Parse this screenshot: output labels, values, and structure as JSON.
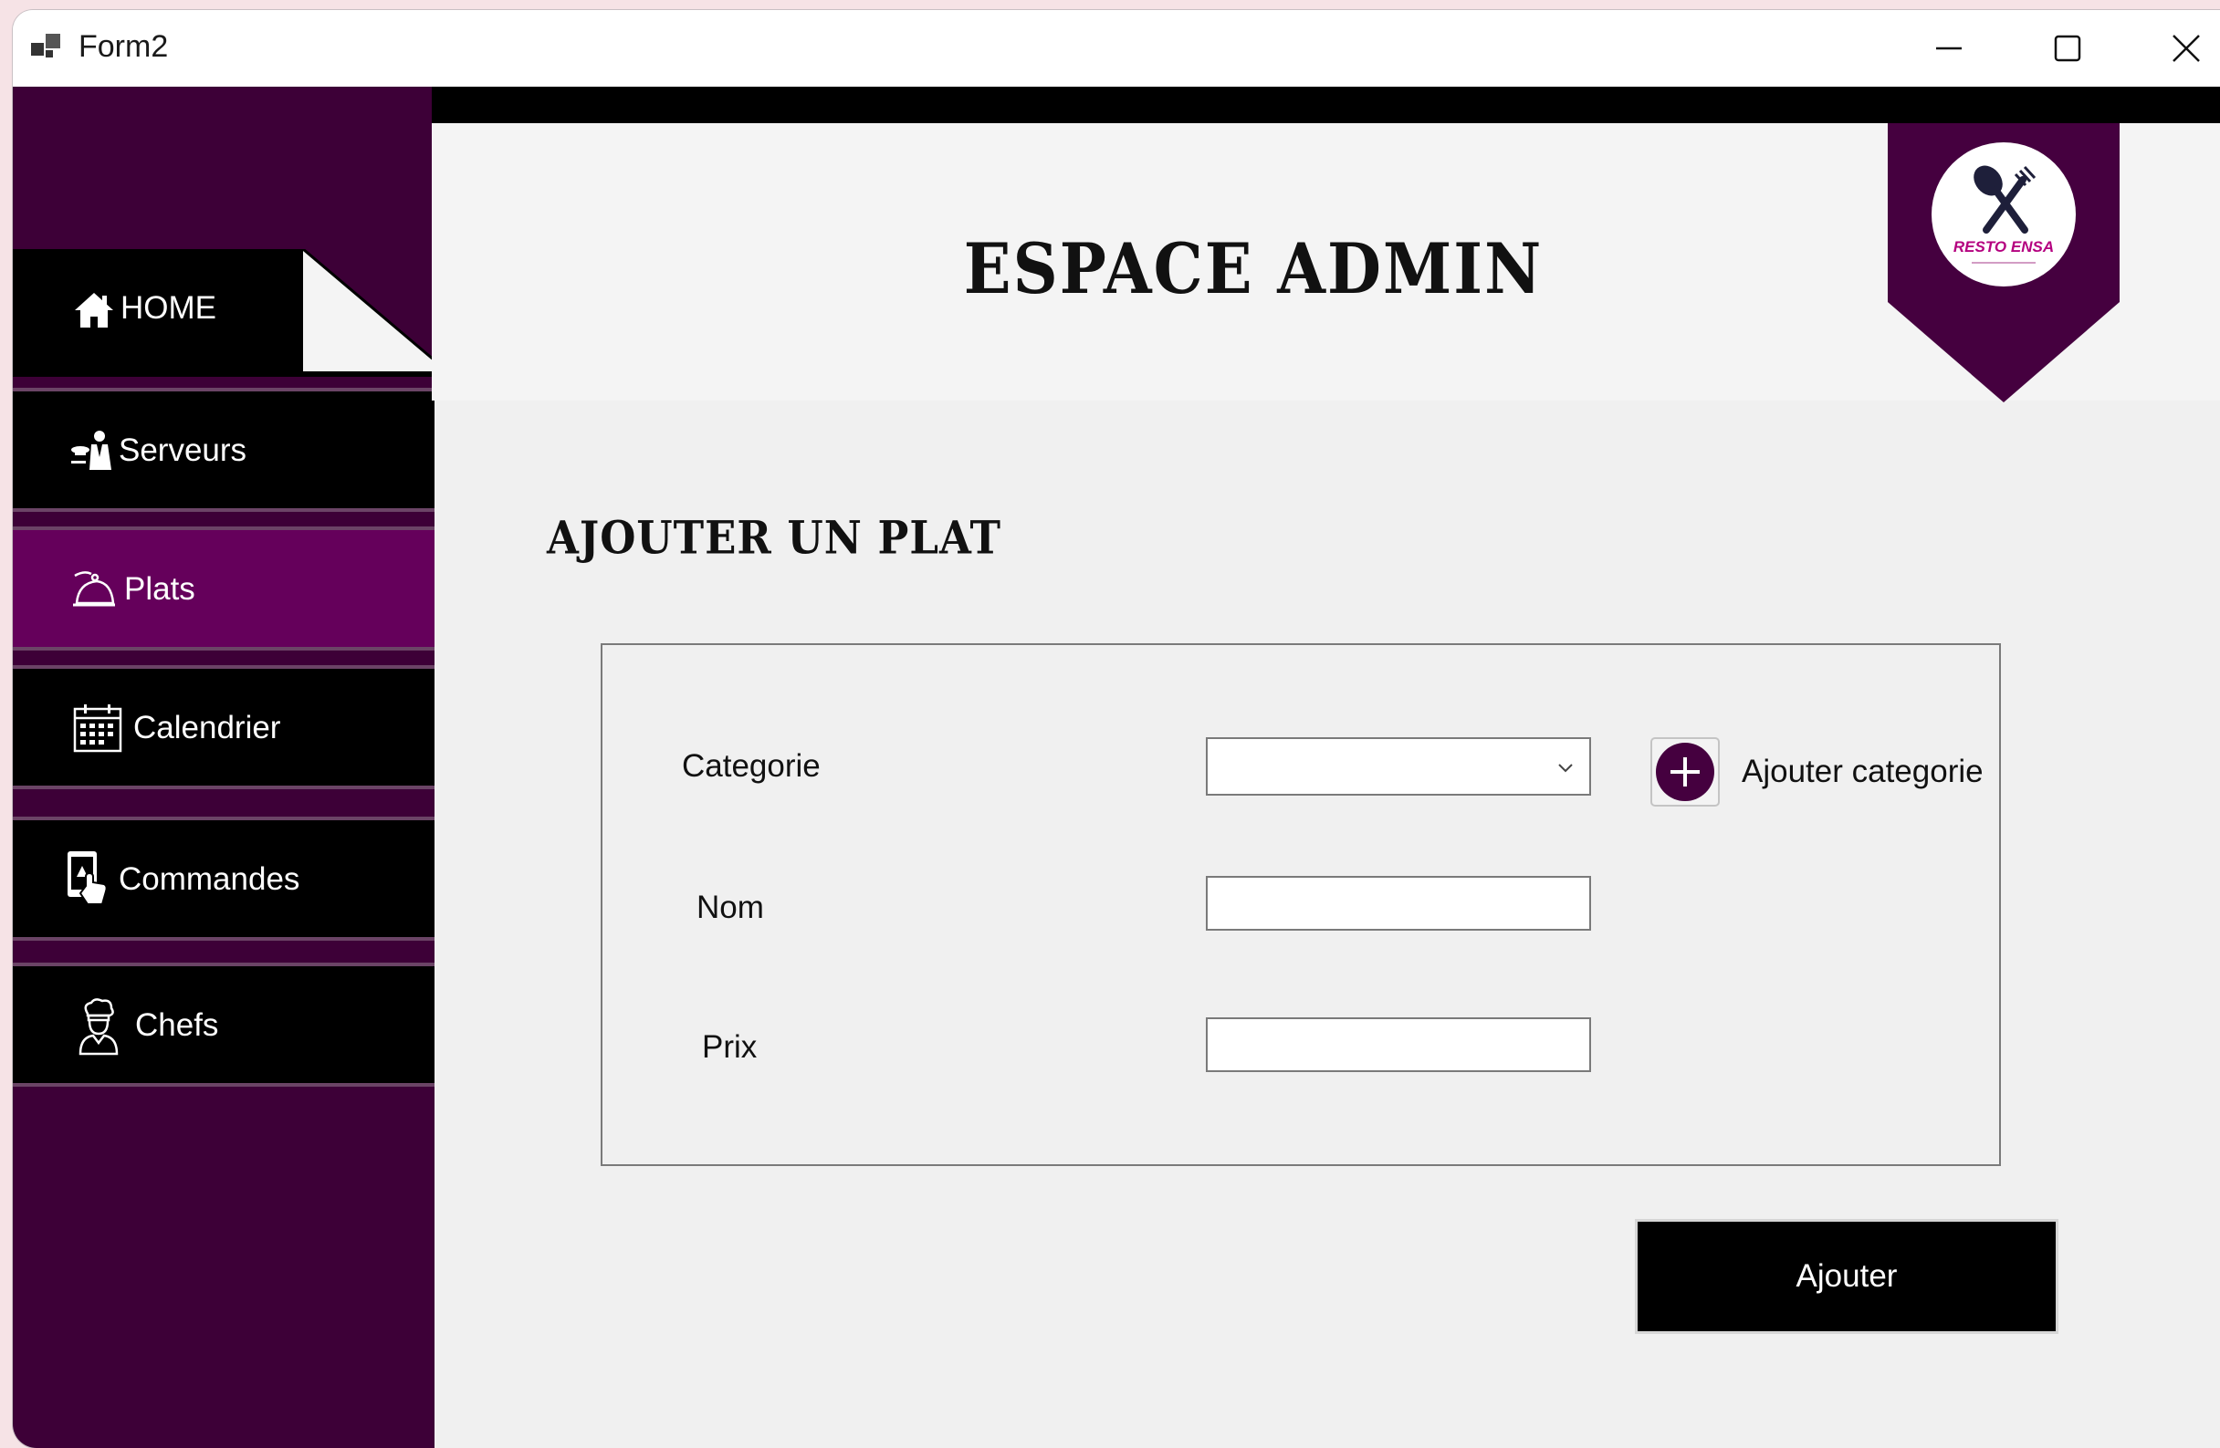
{
  "window": {
    "title": "Form2",
    "controls": [
      "minimize-icon",
      "maximize-icon",
      "close-icon"
    ]
  },
  "sidebar": {
    "items": [
      {
        "label": "HOME",
        "icon": "home-icon",
        "active": false
      },
      {
        "label": "Serveurs",
        "icon": "waiter-icon",
        "active": false
      },
      {
        "label": "Plats",
        "icon": "serving-bell-icon",
        "active": true
      },
      {
        "label": "Calendrier",
        "icon": "calendar-icon",
        "active": false
      },
      {
        "label": "Commandes",
        "icon": "tablet-touch-icon",
        "active": false
      },
      {
        "label": "Chefs",
        "icon": "chef-icon",
        "active": false
      }
    ]
  },
  "header": {
    "title": "ESPACE ADMIN",
    "logo_text": "RESTO ENSA"
  },
  "form": {
    "section_title": "AJOUTER UN PLAT",
    "categorie_label": "Categorie",
    "categorie_value": "",
    "add_category_label": "Ajouter categorie",
    "nom_label": "Nom",
    "nom_value": "",
    "prix_label": "Prix",
    "prix_value": "",
    "submit_label": "Ajouter"
  },
  "colors": {
    "sidebar_bg": "#3d0037",
    "active_item": "#65005b",
    "accent": "#45003f",
    "nav_bg": "#000000",
    "content_bg": "#f0f0f0"
  }
}
